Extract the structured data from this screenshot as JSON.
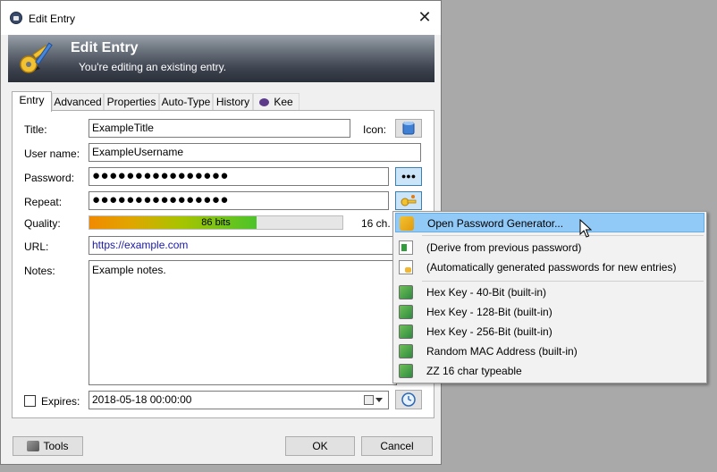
{
  "window": {
    "title": "Edit Entry",
    "close_glyph": "✕"
  },
  "banner": {
    "title": "Edit Entry",
    "subtitle": "You're editing an existing entry."
  },
  "tabs": [
    {
      "label": "Entry",
      "active": true
    },
    {
      "label": "Advanced"
    },
    {
      "label": "Properties"
    },
    {
      "label": "Auto-Type"
    },
    {
      "label": "History"
    },
    {
      "label": "Kee",
      "icon": "kee-icon"
    }
  ],
  "form": {
    "title_label": "Title:",
    "title_value": "ExampleTitle",
    "icon_label": "Icon:",
    "username_label": "User name:",
    "username_value": "ExampleUsername",
    "password_label": "Password:",
    "password_value": "●●●●●●●●●●●●●●●●",
    "reveal_label": "●●●",
    "repeat_label": "Repeat:",
    "repeat_value": "●●●●●●●●●●●●●●●●",
    "quality_label": "Quality:",
    "quality_text": "86 bits",
    "quality_fraction": 0.66,
    "quality_chars": "16 ch.",
    "url_label": "URL:",
    "url_value": "https://example.com",
    "notes_label": "Notes:",
    "notes_value": "Example notes.",
    "expires_label": "Expires:",
    "expires_checked": false,
    "expires_value": "2018-05-18 00:00:00"
  },
  "footer": {
    "tools_label": "Tools",
    "ok_label": "OK",
    "cancel_label": "Cancel"
  },
  "context_menu": {
    "items": [
      {
        "label": "Open Password Generator...",
        "icon": "key-generator-icon",
        "highlighted": true
      },
      {
        "label": "(Derive from previous password)",
        "icon": "derive-document-icon"
      },
      {
        "label": "(Automatically generated passwords for new entries)",
        "icon": "auto-generate-document-icon"
      },
      {
        "label": "Hex Key - 40-Bit (built-in)",
        "icon": "builtin-profile-icon"
      },
      {
        "label": "Hex Key - 128-Bit (built-in)",
        "icon": "builtin-profile-icon"
      },
      {
        "label": "Hex Key - 256-Bit (built-in)",
        "icon": "builtin-profile-icon"
      },
      {
        "label": "Random MAC Address (built-in)",
        "icon": "builtin-profile-icon"
      },
      {
        "label": "ZZ 16 char typeable",
        "icon": "builtin-profile-icon"
      }
    ]
  },
  "colors": {
    "menu_highlight": "#91c9f7",
    "reveal_button": "#cce4f7",
    "url_text": "#1a1aa6",
    "quality_gradient_start": "#f08a00",
    "quality_gradient_end": "#4bc42a"
  }
}
